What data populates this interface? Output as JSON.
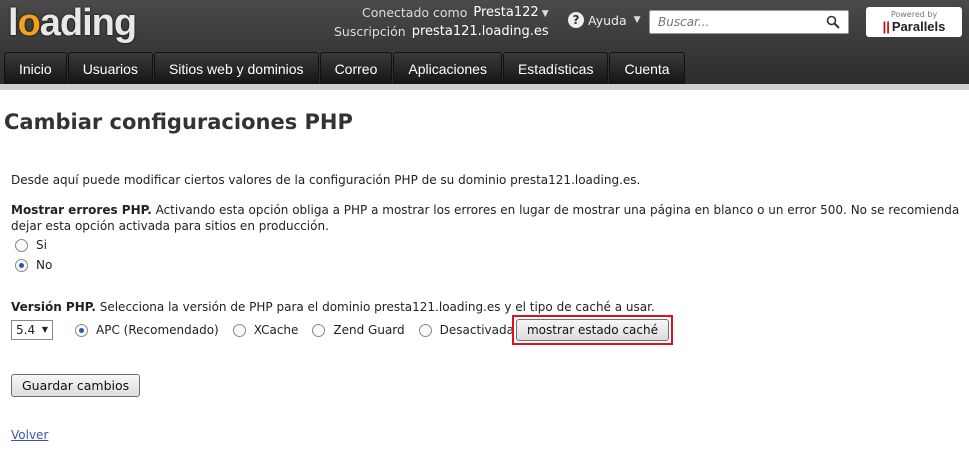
{
  "header": {
    "logo": "loading",
    "connected_label": "Conectado como",
    "username": "Presta122",
    "subscription_label": "Suscripción",
    "subscription": "presta121.loading.es",
    "help_label": "Ayuda",
    "search_placeholder": "Buscar...",
    "powered_by": "Powered by",
    "parallels": "Parallels"
  },
  "nav": {
    "tabs": [
      {
        "label": "Inicio"
      },
      {
        "label": "Usuarios"
      },
      {
        "label": "Sitios web y dominios"
      },
      {
        "label": "Correo"
      },
      {
        "label": "Aplicaciones"
      },
      {
        "label": "Estadísticas"
      },
      {
        "label": "Cuenta"
      }
    ]
  },
  "page": {
    "title": "Cambiar configuraciones PHP",
    "intro": "Desde aquí puede modificar ciertos valores de la configuración PHP de su dominio presta121.loading.es.",
    "errors": {
      "title": "Mostrar errores PHP.",
      "desc": " Activando esta opción obliga a PHP a mostrar los errores en lugar de mostrar una página en blanco o un error 500. No se recomienda dejar esta opción activada para sitios en producción.",
      "options": [
        {
          "label": "Si",
          "checked": false
        },
        {
          "label": "No",
          "checked": true
        }
      ]
    },
    "version": {
      "title": "Versión PHP.",
      "desc": " Selecciona la versión de PHP para el dominio presta121.loading.es y el tipo de caché a usar.",
      "selected": "5.4",
      "cache_options": [
        {
          "label": "APC (Recomendado)",
          "checked": true
        },
        {
          "label": "XCache",
          "checked": false
        },
        {
          "label": "Zend Guard",
          "checked": false
        },
        {
          "label": "Desactivada",
          "checked": false
        }
      ],
      "status_button": "mostrar estado caché"
    },
    "save_button": "Guardar cambios",
    "back_link": "Volver"
  },
  "colors": {
    "header_bg": "#3a3a3a",
    "highlight": "#e01020",
    "link": "#3a55b0"
  }
}
